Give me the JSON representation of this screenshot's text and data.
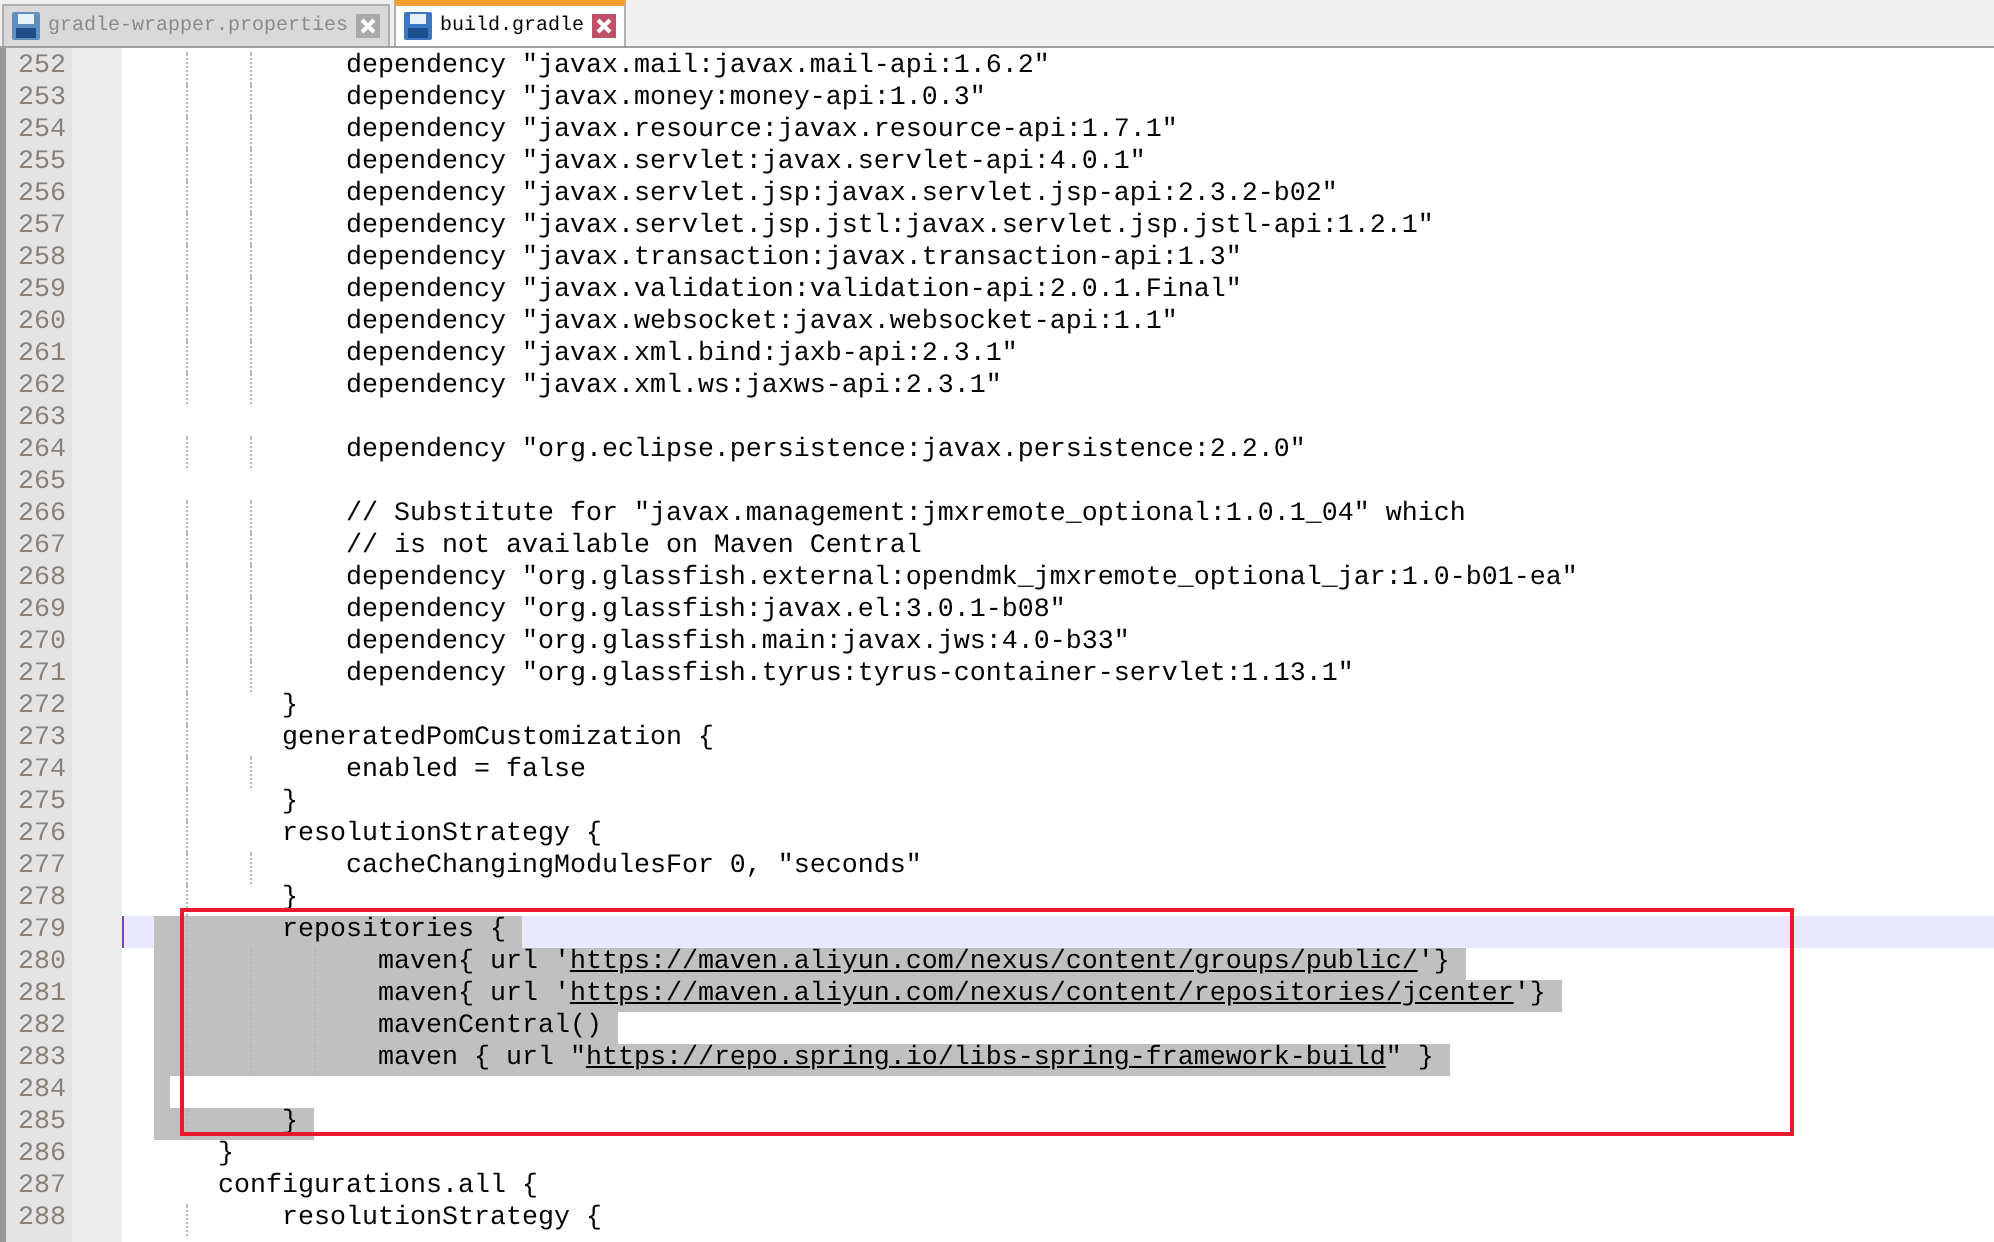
{
  "tabs": [
    {
      "label": "gradle-wrapper.properties",
      "selected": false
    },
    {
      "label": "build.gradle",
      "selected": true
    }
  ],
  "lines": [
    {
      "number": "252",
      "text": "            dependency \"javax.mail:javax.mail-api:1.6.2\"",
      "selected": false,
      "current": false
    },
    {
      "number": "253",
      "text": "            dependency \"javax.money:money-api:1.0.3\"",
      "selected": false,
      "current": false
    },
    {
      "number": "254",
      "text": "            dependency \"javax.resource:javax.resource-api:1.7.1\"",
      "selected": false,
      "current": false
    },
    {
      "number": "255",
      "text": "            dependency \"javax.servlet:javax.servlet-api:4.0.1\"",
      "selected": false,
      "current": false
    },
    {
      "number": "256",
      "text": "            dependency \"javax.servlet.jsp:javax.servlet.jsp-api:2.3.2-b02\"",
      "selected": false,
      "current": false
    },
    {
      "number": "257",
      "text": "            dependency \"javax.servlet.jsp.jstl:javax.servlet.jsp.jstl-api:1.2.1\"",
      "selected": false,
      "current": false
    },
    {
      "number": "258",
      "text": "            dependency \"javax.transaction:javax.transaction-api:1.3\"",
      "selected": false,
      "current": false
    },
    {
      "number": "259",
      "text": "            dependency \"javax.validation:validation-api:2.0.1.Final\"",
      "selected": false,
      "current": false
    },
    {
      "number": "260",
      "text": "            dependency \"javax.websocket:javax.websocket-api:1.1\"",
      "selected": false,
      "current": false
    },
    {
      "number": "261",
      "text": "            dependency \"javax.xml.bind:jaxb-api:2.3.1\"",
      "selected": false,
      "current": false
    },
    {
      "number": "262",
      "text": "            dependency \"javax.xml.ws:jaxws-api:2.3.1\"",
      "selected": false,
      "current": false
    },
    {
      "number": "263",
      "selected": false,
      "current": false
    },
    {
      "number": "264",
      "text": "            dependency \"org.eclipse.persistence:javax.persistence:2.2.0\"",
      "selected": false,
      "current": false
    },
    {
      "number": "265",
      "selected": false,
      "current": false
    },
    {
      "number": "266",
      "text": "            // Substitute for \"javax.management:jmxremote_optional:1.0.1_04\" which",
      "selected": false,
      "current": false
    },
    {
      "number": "267",
      "text": "            // is not available on Maven Central",
      "selected": false,
      "current": false
    },
    {
      "number": "268",
      "text": "            dependency \"org.glassfish.external:opendmk_jmxremote_optional_jar:1.0-b01-ea\"",
      "selected": false,
      "current": false
    },
    {
      "number": "269",
      "text": "            dependency \"org.glassfish:javax.el:3.0.1-b08\"",
      "selected": false,
      "current": false
    },
    {
      "number": "270",
      "text": "            dependency \"org.glassfish.main:javax.jws:4.0-b33\"",
      "selected": false,
      "current": false
    },
    {
      "number": "271",
      "text": "            dependency \"org.glassfish.tyrus:tyrus-container-servlet:1.13.1\"",
      "selected": false,
      "current": false
    },
    {
      "number": "272",
      "text": "        }",
      "selected": false,
      "current": false
    },
    {
      "number": "273",
      "text": "        generatedPomCustomization {",
      "selected": false,
      "current": false
    },
    {
      "number": "274",
      "text": "            enabled = false",
      "selected": false,
      "current": false
    },
    {
      "number": "275",
      "text": "        }",
      "selected": false,
      "current": false
    },
    {
      "number": "276",
      "text": "        resolutionStrategy {",
      "selected": false,
      "current": false
    },
    {
      "number": "277",
      "text": "            cacheChangingModulesFor 0, \"seconds\"",
      "selected": false,
      "current": false
    },
    {
      "number": "278",
      "text": "        }",
      "selected": false,
      "current": false
    },
    {
      "number": "279",
      "text": "        repositories {",
      "selected": true,
      "current": true
    },
    {
      "number": "280",
      "parts": [
        {
          "text": "              maven{ url '",
          "link": false
        },
        {
          "text": "https://maven.aliyun.com/nexus/content/groups/public/",
          "link": true
        },
        {
          "text": "'}",
          "link": false
        }
      ],
      "selected": true,
      "current": false
    },
    {
      "number": "281",
      "parts": [
        {
          "text": "              maven{ url '",
          "link": false
        },
        {
          "text": "https://maven.aliyun.com/nexus/content/repositories/jcenter",
          "link": true
        },
        {
          "text": "'}",
          "link": false
        }
      ],
      "selected": true,
      "current": false
    },
    {
      "number": "282",
      "text": "              mavenCentral()",
      "selected": true,
      "current": false
    },
    {
      "number": "283",
      "parts": [
        {
          "text": "              maven { url \"",
          "link": false
        },
        {
          "text": "https://repo.spring.io/libs-spring-framework-build",
          "link": true
        },
        {
          "text": "\" }",
          "link": false
        }
      ],
      "selected": true,
      "current": false
    },
    {
      "number": "284",
      "selected": true,
      "current": false
    },
    {
      "number": "285",
      "text": "        }",
      "selected": true,
      "current": false
    },
    {
      "number": "286",
      "text": "    }",
      "selected": false,
      "current": false
    },
    {
      "number": "287",
      "text": "    configurations.all {",
      "selected": false,
      "current": false
    },
    {
      "number": "288",
      "text": "        resolutionStrategy {",
      "selected": false,
      "current": false
    }
  ]
}
